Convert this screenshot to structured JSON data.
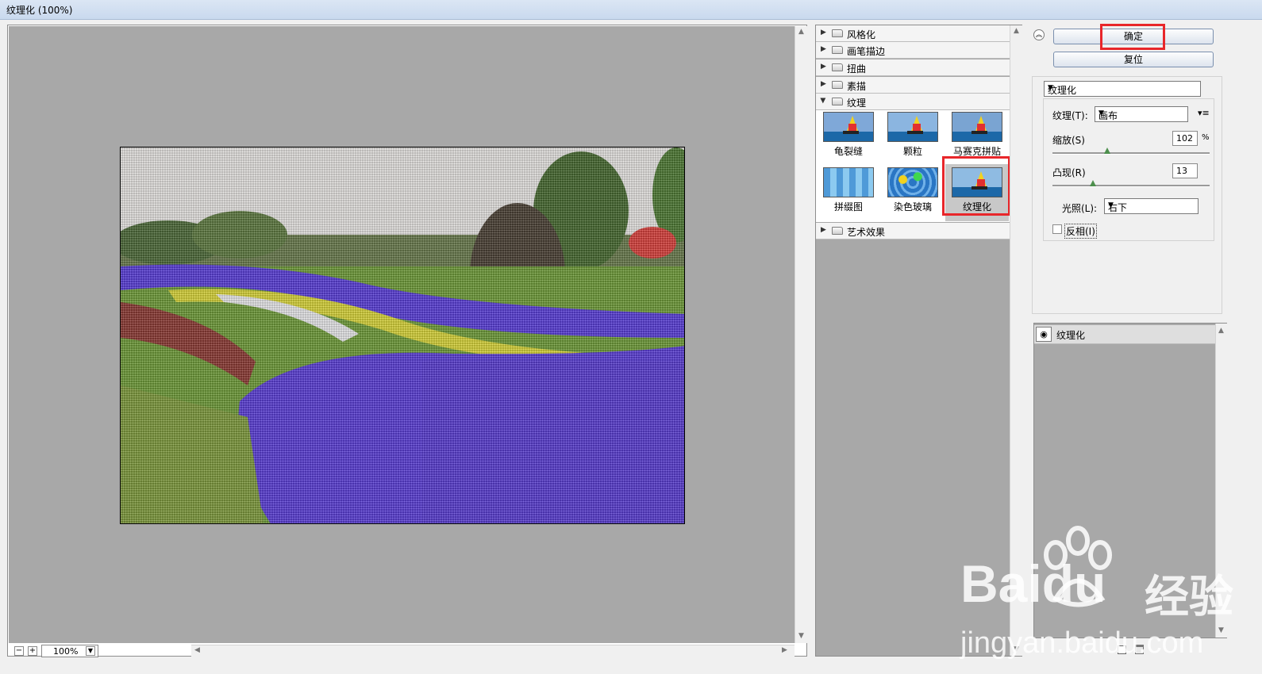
{
  "window": {
    "title": "纹理化 (100%)"
  },
  "zoom": {
    "minus": "−",
    "plus": "+",
    "value": "100%"
  },
  "filter_groups": [
    {
      "label": "风格化",
      "expanded": false
    },
    {
      "label": "画笔描边",
      "expanded": false
    },
    {
      "label": "扭曲",
      "expanded": false
    },
    {
      "label": "素描",
      "expanded": false
    },
    {
      "label": "纹理",
      "expanded": true
    },
    {
      "label": "艺术效果",
      "expanded": false
    }
  ],
  "texture_filters": [
    {
      "label": "龟裂缝"
    },
    {
      "label": "颗粒"
    },
    {
      "label": "马赛克拼贴"
    },
    {
      "label": "拼缀图"
    },
    {
      "label": "染色玻璃"
    },
    {
      "label": "纹理化",
      "selected": true
    }
  ],
  "buttons": {
    "ok": "确定",
    "reset": "复位"
  },
  "filter_select": {
    "value": "纹理化"
  },
  "settings": {
    "texture_label": "纹理(T):",
    "texture_value": "画布",
    "scale_label": "缩放(S)",
    "scale_value": "102",
    "scale_unit": "%",
    "scale_level": 102,
    "relief_label": "凸现(R)",
    "relief_value": "13",
    "relief_level": 13,
    "light_label": "光照(L):",
    "light_value": "右下",
    "invert_label": "反相(I)",
    "invert_checked": false
  },
  "layers": [
    {
      "label": "纹理化"
    }
  ],
  "watermark": {
    "brand": "Bai",
    "brand2": "du",
    "brand_cn": "经验",
    "url": "jingyan.baidu.com"
  },
  "colors": {
    "highlight": "#e8262a",
    "preview_bg": "#a8a8a8"
  }
}
